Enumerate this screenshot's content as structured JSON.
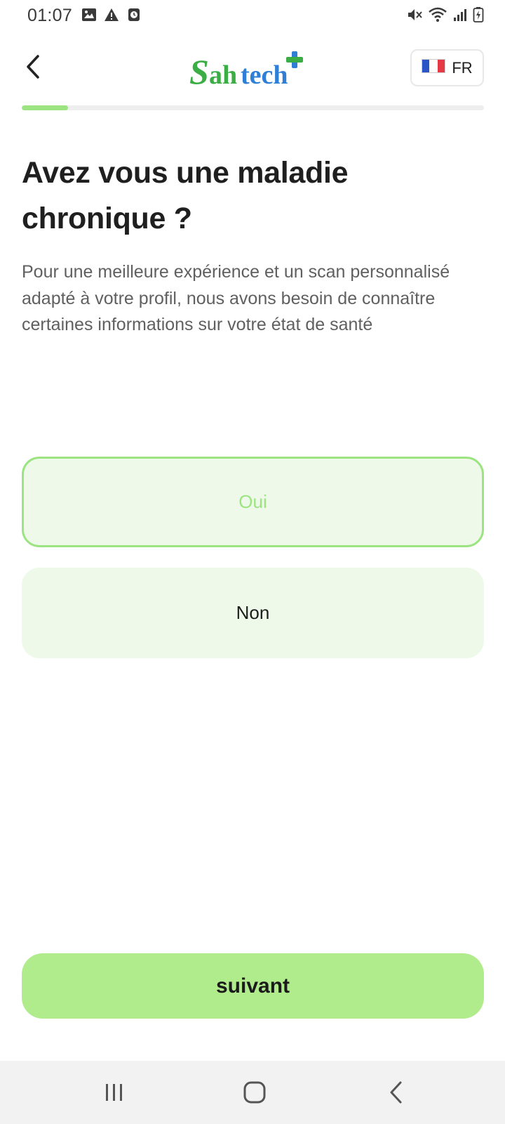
{
  "status_bar": {
    "time": "01:07",
    "left_icons": [
      "image-icon",
      "warning-icon",
      "alarm-icon"
    ],
    "right_icons": [
      "mute-icon",
      "wifi-icon",
      "signal-icon",
      "battery-charging-icon"
    ]
  },
  "header": {
    "logo_text": "Sahtech",
    "language": {
      "flag": "🇫🇷",
      "code": "FR"
    }
  },
  "progress": {
    "fraction": 0.1
  },
  "question": {
    "title": "Avez vous une maladie chronique ?",
    "description": "Pour une meilleure expérience et un scan personnalisé adapté à votre profil, nous avons besoin de connaître certaines informations sur votre état de santé"
  },
  "options": [
    {
      "label": "Oui",
      "selected": true
    },
    {
      "label": "Non",
      "selected": false
    }
  ],
  "next_button": {
    "label": "suivant"
  },
  "nav_bar": {
    "buttons": [
      "recent-apps-icon",
      "home-icon",
      "back-icon"
    ]
  },
  "colors": {
    "accent": "#9ce481",
    "accent_light": "#eff9ea",
    "button": "#b1ec8c",
    "logo_green": "#3aad45",
    "logo_blue": "#2f7fd6"
  }
}
